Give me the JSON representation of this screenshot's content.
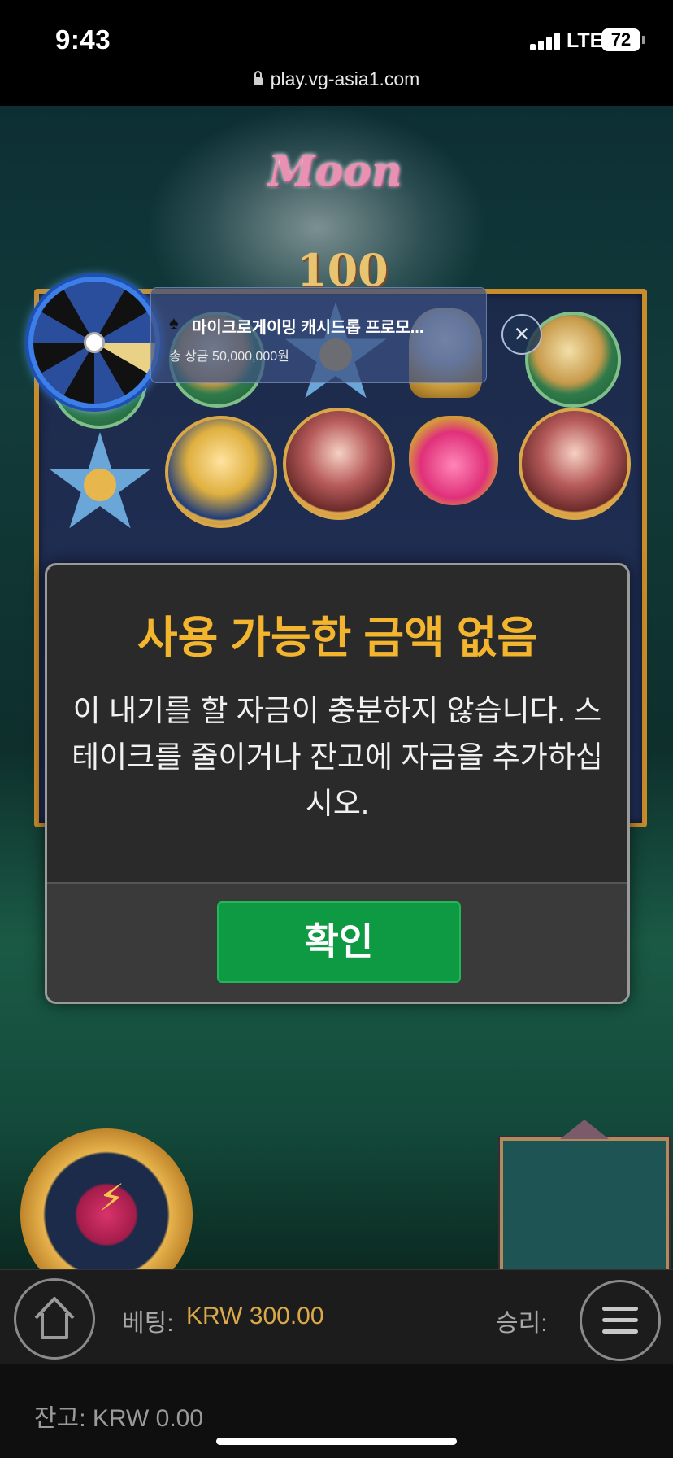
{
  "status": {
    "time": "9:43",
    "network": "LTE",
    "battery": "72"
  },
  "browser": {
    "url": "play.vg-asia1.com"
  },
  "game": {
    "logo_line1": "Moon",
    "logo_line2": "100"
  },
  "promo": {
    "title": "마이크로게이밍 캐시드롭 프로모...",
    "prize": "총 상금 50,000,000원",
    "close_symbol": "×"
  },
  "dialog": {
    "title": "사용 가능한 금액 없음",
    "message": "이 내기를 할 자금이 충분하지 않습니다. 스테이크를 줄이거나 잔고에 자금을 추가하십시오.",
    "confirm_label": "확인"
  },
  "footer": {
    "bet_label": "베팅:",
    "bet_value": "KRW 300.00",
    "win_label": "승리:",
    "balance": "잔고: KRW 0.00"
  },
  "colors": {
    "title": "#f4b52e",
    "confirm": "#0e9a43",
    "bet_value": "#d9a94a"
  }
}
